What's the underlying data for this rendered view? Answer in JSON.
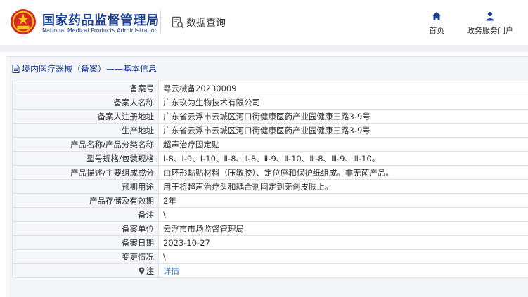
{
  "header": {
    "brand_cn": "国家药品监督管理局",
    "brand_en": "National Medical Products Administration",
    "query_label": "数据查询",
    "nav": [
      {
        "label": "首页",
        "icon": "home-icon"
      },
      {
        "label": "政务服务门户",
        "icon": "user-icon"
      }
    ]
  },
  "panel": {
    "title": "境内医疗器械（备案）——基本信息"
  },
  "records": [
    {
      "label": "备案号",
      "value": "粤云械备20230009"
    },
    {
      "label": "备案人名称",
      "value": "广东玖为生物技术有限公司"
    },
    {
      "label": "备案人注册地址",
      "value": "广东省云浮市云城区河口街健康医药产业园健康三路3-9号"
    },
    {
      "label": "生产地址",
      "value": "广东省云浮市云城区河口街健康医药产业园健康三路3-9号"
    },
    {
      "label": "产品名称/产品分类名称",
      "value": "超声治疗固定贴"
    },
    {
      "label": "型号规格/包装规格",
      "value": "Ⅰ-8、Ⅰ-9、Ⅰ-10、Ⅱ-8、Ⅱ-8、Ⅱ-9、Ⅱ-10、Ⅲ-8、Ⅲ-9、Ⅲ-10。"
    },
    {
      "label": "产品描述/主要组成成分",
      "value": "由环形黏贴材料（压敏胶）、定位座和保护纸组成。非无菌产品。"
    },
    {
      "label": "预期用途",
      "value": "用于将超声治疗头和耦合剂固定到无创皮肤上。"
    },
    {
      "label": "产品存储及有效期",
      "value": "2年"
    },
    {
      "label": "备注",
      "value": "\\"
    },
    {
      "label": "备案单位",
      "value": "云浮市市场监督管理局"
    },
    {
      "label": "备案日期",
      "value": "2023-10-27"
    },
    {
      "label": "变更情况",
      "value": "\\"
    },
    {
      "label": "注",
      "value": "详情"
    }
  ],
  "colors": {
    "brand": "#1d3f8f",
    "link": "#2a6fcf",
    "emblem_red": "#d42b20",
    "emblem_gold": "#f5c518"
  }
}
